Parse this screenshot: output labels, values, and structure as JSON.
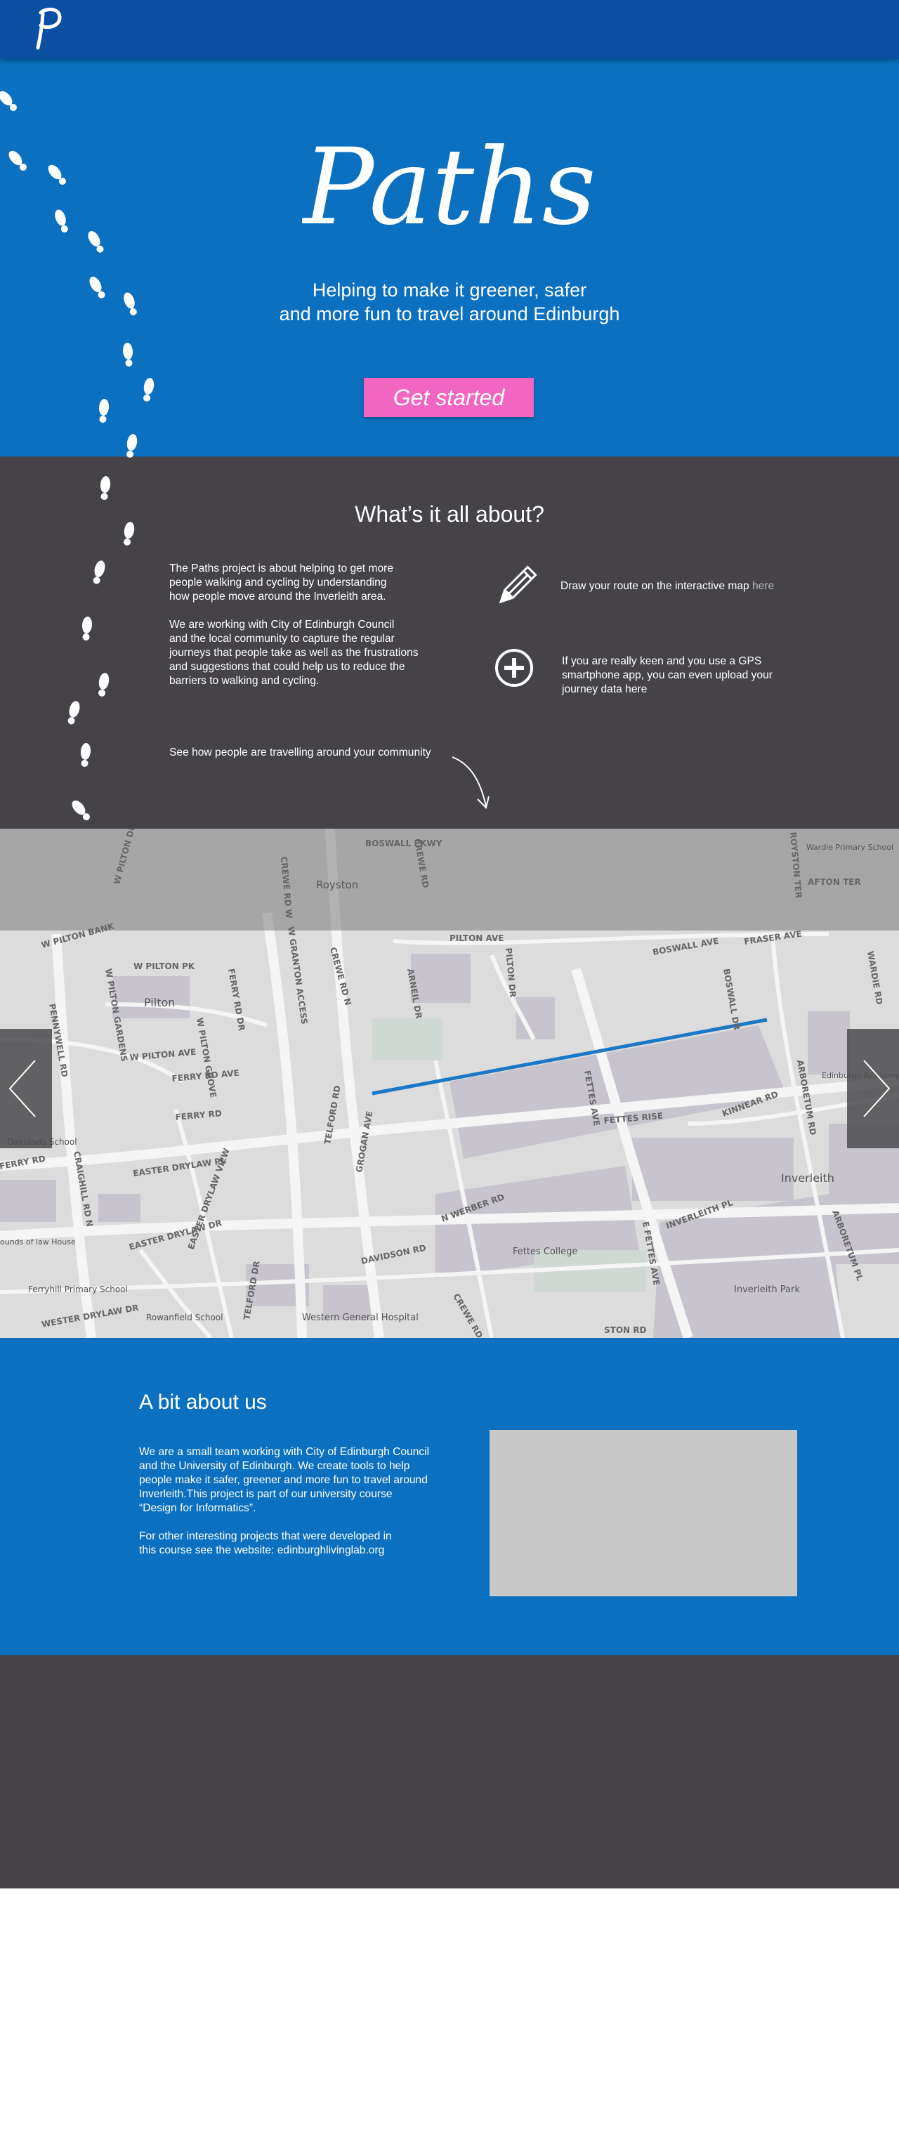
{
  "header": {
    "logo_letter": "p"
  },
  "hero": {
    "title": "Paths",
    "subtitle_line1": "Helping to make it greener, safer",
    "subtitle_line2": "and more fun to travel around Edinburgh",
    "cta_label": "Get started"
  },
  "about": {
    "title": "What’s it all about?",
    "p1": [
      "The Paths project is about helping to get more",
      "people walking and cycling by understanding",
      "how people move around the Inverleith area."
    ],
    "p2": [
      "We are working with City of Edinburgh Council",
      "and the local community to capture the regular",
      "journeys that people take as well as the frustrations",
      "and suggestions that could help us to reduce the",
      "barriers to walking and cycling."
    ],
    "feature1_text": "Draw your route on the interactive map ",
    "feature1_link": "here",
    "feature2": [
      "If you are really keen and you use a GPS",
      "smartphone app, you can even upload your",
      "journey data here"
    ],
    "see_how": "See how people are travelling around your community"
  },
  "map": {
    "streets": [
      "BOSWALL PKWY",
      "W PILTON DR",
      "CREWE RD W",
      "PILTON AVE",
      "AFTON TER",
      "W PILTON BANK",
      "W PILTON PK",
      "W PILTON GARDENS",
      "FERRY RD DR",
      "CREWE RD N",
      "ARNEIL DR",
      "PILTON DR",
      "BOSWALL AVE",
      "FRASER AVE",
      "W GRANTON ACCESS",
      "W PILTON AVE",
      "W PILTON GROVE",
      "FERRY RD AVE",
      "PENNYWELL RD",
      "FERRY RD",
      "FETTES AVE",
      "FETTES RISE",
      "KINNEAR RD",
      "ARBORETUM RD",
      "EASTER DRYLAW PL",
      "CRAIGHILL RD N",
      "TELFORD RD",
      "GROGAN AVE",
      "N WERBER RD",
      "INVERLEITH PL",
      "EASTER DRYLAW DR",
      "DAVIDSON RD",
      "WESTER DRYLAW DR",
      "E FETTES AVE",
      "ARBORETUM PL",
      "WARDIE RD",
      "ROYSTON TER",
      "STON RD",
      "FERRY RD",
      "CREWE RD",
      "EASTER DRYLAW VIEW",
      "TELFORD DR",
      "BOSWALL DR",
      "CREWE RD"
    ],
    "places": [
      "Royston",
      "Pilton",
      "Oaklands School",
      "Ferryhill Primary School",
      "Rowanfield School",
      "Western General Hospital",
      "Fettes College",
      "Inverleith",
      "Inverleith Park",
      "Edinburgh Academy Junior School",
      "Wardie Primary School",
      "ounds of law House"
    ],
    "route_color": "#1b78c6",
    "prev_icon": "chevron-left-icon",
    "next_icon": "chevron-right-icon"
  },
  "bit": {
    "title": "A bit about us",
    "p1": [
      "We are a small team working with City of Edinburgh Council",
      "and the University of Edinburgh. We create tools to help",
      "people make it safer, greener and more fun to travel around",
      "Inverleith.This project is part of our university course",
      "“Design for Informatics”."
    ],
    "p2": [
      "For other interesting projects that were developed in",
      "this course see the website: edinburghlivinglab.org"
    ]
  },
  "colors": {
    "header": "#0b4fa3",
    "hero": "#0b70bf",
    "dark": "#454348",
    "cta": "#f265c1"
  }
}
